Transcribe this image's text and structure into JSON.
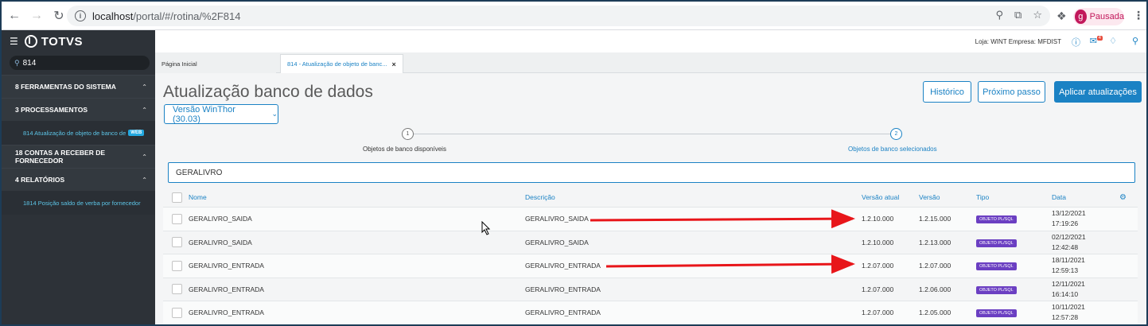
{
  "browser": {
    "url_host": "localhost",
    "url_path": "/portal/#/rotina/%2F814",
    "profile_initial": "g",
    "profile_label": "Pausada"
  },
  "sidebar": {
    "brand": "TOTVS",
    "search_value": "814",
    "items": [
      {
        "label": "8  FERRAMENTAS DO SISTEMA"
      },
      {
        "label": "3  PROCESSAMENTOS"
      },
      {
        "sub_label": "814   Atualização de objeto de banco de",
        "badge": "WEB"
      },
      {
        "label": "18  CONTAS A RECEBER DE FORNECEDOR"
      },
      {
        "label": "4  RELATÓRIOS"
      },
      {
        "sub_label": "1814   Posição saldo de verba por fornecedor"
      }
    ]
  },
  "topbar": {
    "store_text": "Loja: WINT   Empresa: MFDIST",
    "mail_count": "4"
  },
  "tabs": [
    {
      "label": "Página Inicial"
    },
    {
      "label": "814 - Atualização de objeto de banc...",
      "close": "×"
    }
  ],
  "page": {
    "title": "Atualização banco de dados",
    "btn_historico": "Histórico",
    "btn_proximo": "Próximo passo",
    "btn_aplicar": "Aplicar atualizações",
    "version_select": "Versão WinThor (30.03)"
  },
  "stepper": {
    "step1_num": "1",
    "step1_label": "Objetos de banco disponíveis",
    "step2_num": "2",
    "step2_label": "Objetos de banco selecionados"
  },
  "filter_value": "GERALIVRO",
  "table": {
    "headers": {
      "nome": "Nome",
      "descricao": "Descrição",
      "versao_atual": "Versão atual",
      "versao": "Versão",
      "tipo": "Tipo",
      "data": "Data"
    },
    "rows": [
      {
        "nome": "GERALIVRO_SAIDA",
        "descricao": "GERALIVRO_SAIDA",
        "versao_atual": "1.2.10.000",
        "versao": "1.2.15.000",
        "tipo": "OBJETO PL/SQL",
        "data_d": "13/12/2021",
        "data_t": "17:19:26"
      },
      {
        "nome": "GERALIVRO_SAIDA",
        "descricao": "GERALIVRO_SAIDA",
        "versao_atual": "1.2.10.000",
        "versao": "1.2.13.000",
        "tipo": "OBJETO PL/SQL",
        "data_d": "02/12/2021",
        "data_t": "12:42:48"
      },
      {
        "nome": "GERALIVRO_ENTRADA",
        "descricao": "GERALIVRO_ENTRADA",
        "versao_atual": "1.2.07.000",
        "versao": "1.2.07.000",
        "tipo": "OBJETO PL/SQL",
        "data_d": "18/11/2021",
        "data_t": "12:59:13"
      },
      {
        "nome": "GERALIVRO_ENTRADA",
        "descricao": "GERALIVRO_ENTRADA",
        "versao_atual": "1.2.07.000",
        "versao": "1.2.06.000",
        "tipo": "OBJETO PL/SQL",
        "data_d": "12/11/2021",
        "data_t": "16:14:10"
      },
      {
        "nome": "GERALIVRO_ENTRADA",
        "descricao": "GERALIVRO_ENTRADA",
        "versao_atual": "1.2.07.000",
        "versao": "1.2.05.000",
        "tipo": "OBJETO PL/SQL",
        "data_d": "10/11/2021",
        "data_t": "12:57:28"
      }
    ]
  },
  "colors": {
    "accent": "#1b82c4",
    "sidebar_bg": "#2d3238",
    "badge_purple": "#6b3fc2",
    "annotation_red": "#e8161a"
  }
}
